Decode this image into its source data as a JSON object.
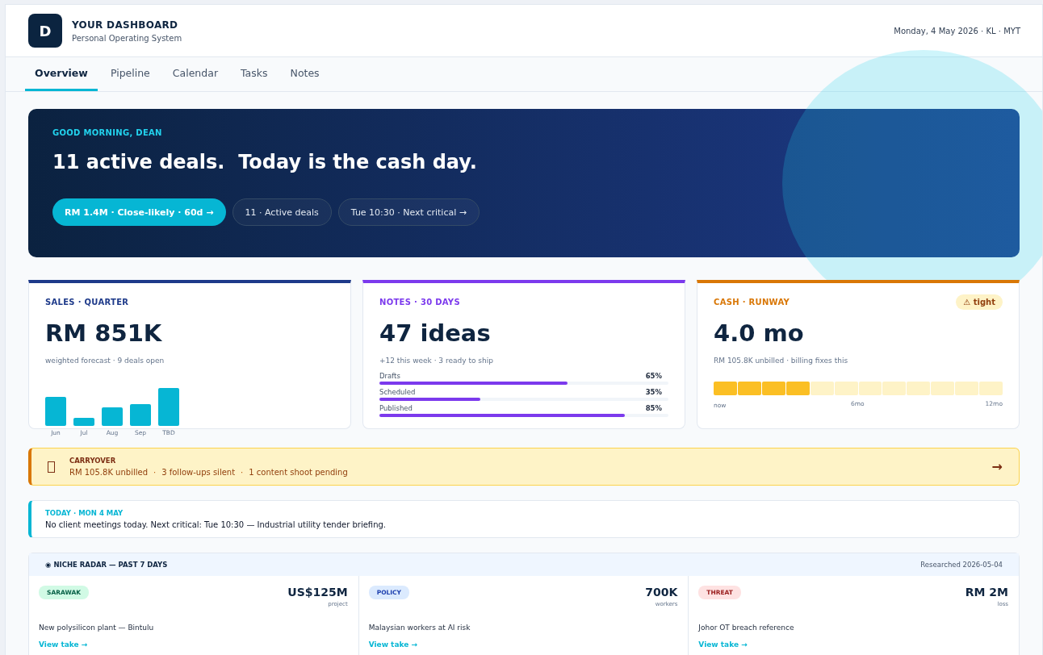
{
  "brand": {
    "logo": "D",
    "title": "YOUR DASHBOARD",
    "subtitle": "Personal Operating System"
  },
  "date": "Monday, 4 May 2026 · KL · MYT",
  "tabs": [
    {
      "label": "Overview",
      "selected": true
    },
    {
      "label": "Pipeline",
      "selected": false
    },
    {
      "label": "Calendar",
      "selected": false
    },
    {
      "label": "Tasks",
      "selected": false
    },
    {
      "label": "Notes",
      "selected": false
    }
  ],
  "hero": {
    "greeting": "GOOD MORNING, DEAN",
    "headline": "11 active deals.  Today is the cash day.",
    "pills": [
      {
        "label": "RM 1.4M · Close-likely · 60d →",
        "kind": "primary"
      },
      {
        "label": "11 · Active deals",
        "kind": "ghost"
      },
      {
        "label": "Tue 10:30 · Next critical →",
        "kind": "ghost"
      }
    ]
  },
  "sales": {
    "title": "SALES · QUARTER",
    "value": "RM 851K",
    "caption": "weighted forecast · 9 deals open",
    "months": [
      "Jun",
      "Jul",
      "Aug",
      "Sep",
      "TBD"
    ],
    "color": "#1e3a8a"
  },
  "notes": {
    "title": "NOTES · 30 DAYS",
    "value": "47 ideas",
    "caption": "+12 this week · 3 ready to ship",
    "color": "#7c3aed",
    "bars": [
      {
        "label": "Drafts",
        "reading": "65%",
        "level": 0.65
      },
      {
        "label": "Scheduled",
        "reading": "35%",
        "level": 0.35
      },
      {
        "label": "Published",
        "reading": "85%",
        "level": 0.85
      }
    ]
  },
  "cash": {
    "title": "CASH · RUNWAY",
    "badge": "⚠ tight",
    "value": "4.0 mo",
    "caption": "RM 105.8K unbilled · billing fixes this",
    "color": "#d97706",
    "level": 0.333,
    "scale": [
      "now",
      "6mo",
      "12mo"
    ]
  },
  "carryover": {
    "title": "CARRYOVER",
    "items": [
      "RM 105.8K unbilled",
      "3 follow-ups silent",
      "1 content shoot pending"
    ],
    "separator": "·",
    "arrow": "→"
  },
  "today": {
    "title": "TODAY · MON 4 MAY",
    "text": "No client meetings today. Next critical: Tue 10:30 — Industrial utility tender briefing."
  },
  "radar": {
    "title": "◉ NICHE RADAR — PAST 7 DAYS",
    "researched": "Researched 2026-05-04",
    "items": [
      {
        "tag": "SARAWAK",
        "color": "#d1fae5",
        "value": "US$125M",
        "unit": "project",
        "title": "New polysilicon plant — Bintulu",
        "link": "View take →"
      },
      {
        "tag": "POLICY",
        "color": "#dbeafe",
        "value": "700K",
        "unit": "workers",
        "title": "Malaysian workers at AI risk",
        "link": "View take →"
      },
      {
        "tag": "THREAT",
        "color": "#fee2e2",
        "value": "RM 2M",
        "unit": "loss",
        "title": "Johor OT breach reference",
        "link": "View take →"
      }
    ]
  }
}
